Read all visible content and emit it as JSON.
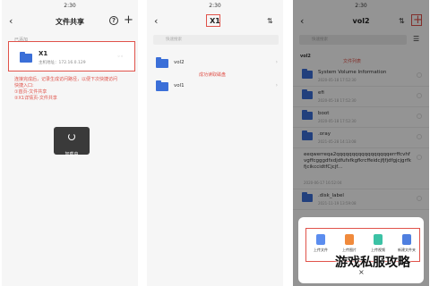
{
  "colors": {
    "accent_red": "#e0524a",
    "folder_blue": "#3b6fd8"
  },
  "screen1": {
    "status_time": "2:30",
    "title": "文件共享",
    "section_label": "已添加",
    "device_name": "X1",
    "device_host": "主机地址：172.16.0.129",
    "note_lines": [
      "连接完成后，记录生成访问路径，以便下次快捷访问",
      "快捷入口:",
      "①首页-文件共享",
      "②X1详情页-文件共享"
    ],
    "loading_text": "加载中"
  },
  "screen2": {
    "status_time": "2:30",
    "title": "X1",
    "search_placeholder": "快速搜索",
    "folders": [
      "vol2",
      "vol1"
    ],
    "annotation": "成功读取磁盘"
  },
  "screen3": {
    "status_time": "2:30",
    "title": "vol2",
    "search_placeholder": "快速搜索",
    "section": "vol2",
    "annotation": "文件列表",
    "items": [
      {
        "name": "System Volume Information",
        "date": "2020-05-18 17:52:30"
      },
      {
        "name": "efi",
        "date": "2020-05-18 17:52:30"
      },
      {
        "name": "boot",
        "date": "2020-05-18 17:52:30"
      },
      {
        "name": ".oray",
        "date": "2021-05-28 14:13:08"
      },
      {
        "name": "eeqwerreqa2qqqqqqqqqqqqqqqqqerrffcvhfvgffcgggdfxdjdfufsfkgfkrcffeidcjfjfjdfgjcjgrfkfjcikccidtfCjcjf...",
        "date": "2020-06-17 16:52:04"
      },
      {
        "name": ".disk_label",
        "date": "2021-11-19 13:59:08"
      }
    ],
    "actions": [
      "上传文件",
      "上传图片",
      "上传视频",
      "新建文件夹"
    ],
    "close_icon": "×"
  },
  "watermark": "游戏私服攻略"
}
